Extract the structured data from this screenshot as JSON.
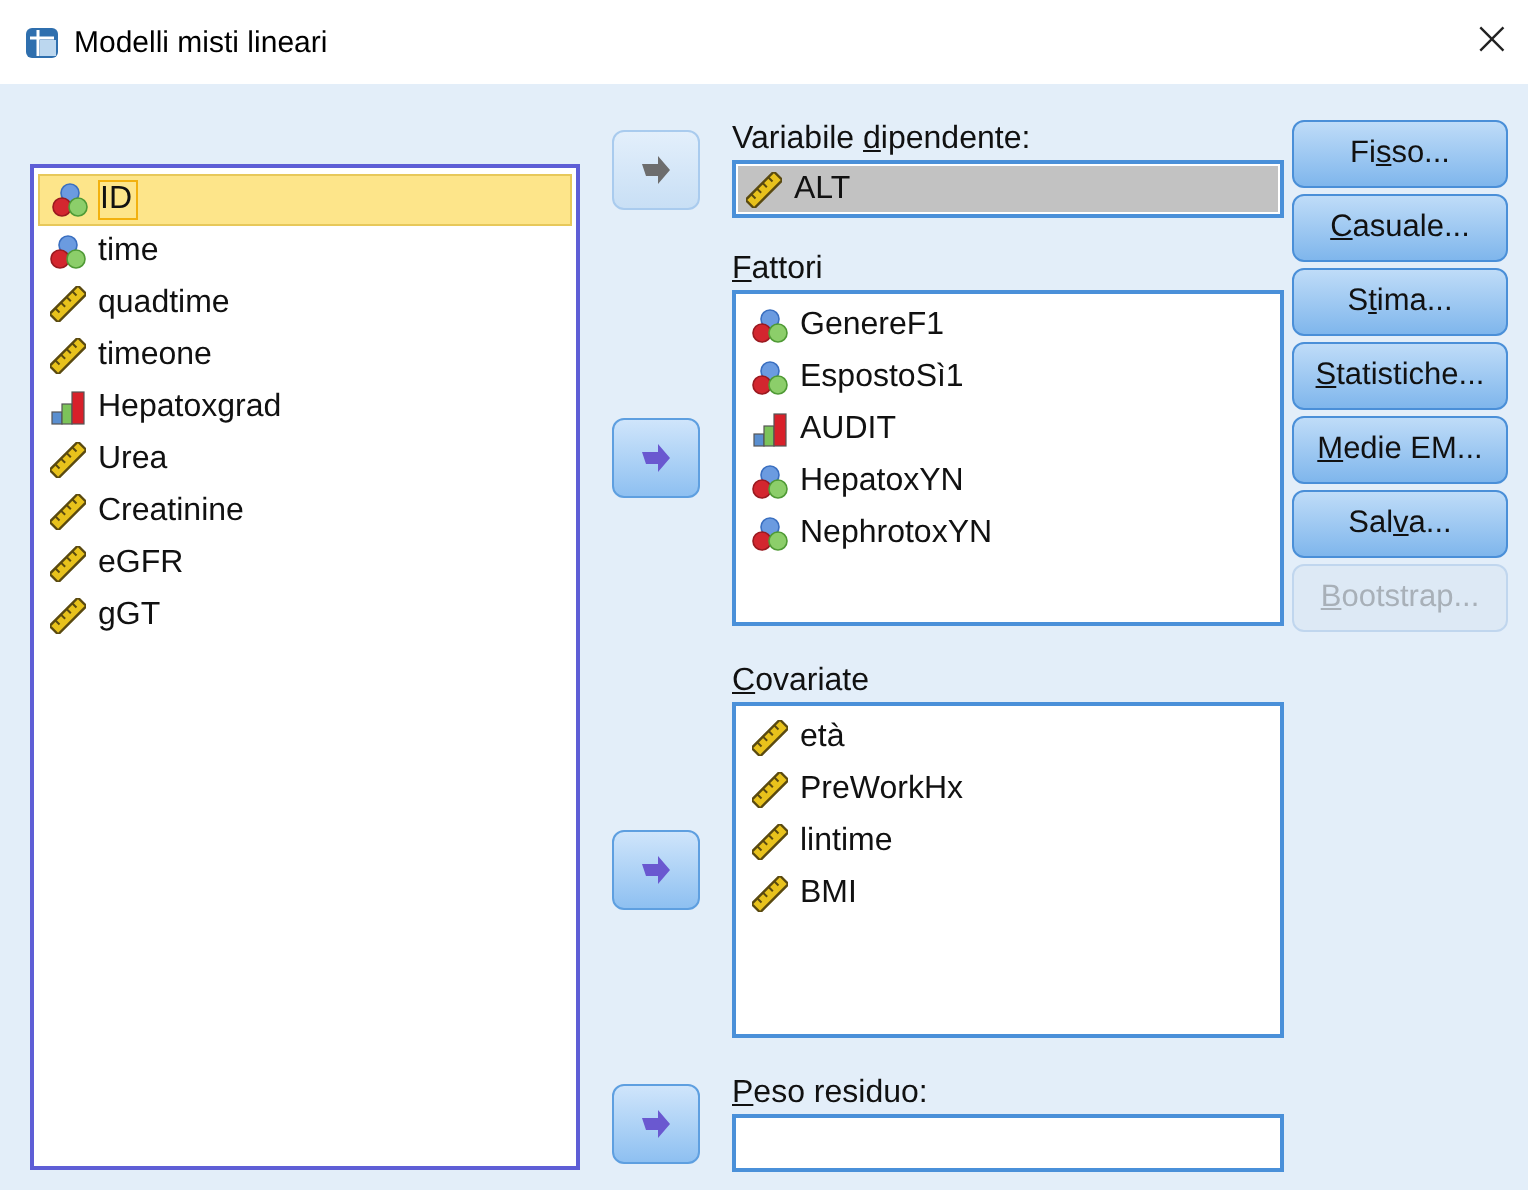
{
  "window": {
    "title": "Modelli misti lineari",
    "close": "×"
  },
  "variables": [
    {
      "name": "ID",
      "kind": "nominal",
      "selected": true
    },
    {
      "name": "time",
      "kind": "nominal",
      "selected": false
    },
    {
      "name": "quadtime",
      "kind": "scale",
      "selected": false
    },
    {
      "name": "timeone",
      "kind": "scale",
      "selected": false
    },
    {
      "name": "Hepatoxgrad",
      "kind": "ordinal",
      "selected": false
    },
    {
      "name": "Urea",
      "kind": "scale",
      "selected": false
    },
    {
      "name": "Creatinine",
      "kind": "scale",
      "selected": false
    },
    {
      "name": "eGFR",
      "kind": "scale",
      "selected": false
    },
    {
      "name": "gGT",
      "kind": "scale",
      "selected": false
    }
  ],
  "sections": [
    {
      "kind": "field",
      "label": {
        "before": "Variabile ",
        "key": "d",
        "after": "ipendente:"
      },
      "arrow_enabled": false,
      "items": [
        {
          "name": "ALT",
          "kind": "scale",
          "selected": true
        }
      ]
    },
    {
      "kind": "list",
      "label": {
        "key": "F",
        "after": "attori"
      },
      "arrow_enabled": true,
      "items": [
        {
          "name": "GenereF1",
          "kind": "nominal",
          "selected": false
        },
        {
          "name": "EspostoSì1",
          "kind": "nominal",
          "selected": false
        },
        {
          "name": "AUDIT",
          "kind": "ordinal",
          "selected": false
        },
        {
          "name": "HepatoxYN",
          "kind": "nominal",
          "selected": false
        },
        {
          "name": "NephrotoxYN",
          "kind": "nominal",
          "selected": false
        }
      ]
    },
    {
      "kind": "list",
      "label": {
        "key": "C",
        "after": "ovariate"
      },
      "arrow_enabled": true,
      "items": [
        {
          "name": "età",
          "kind": "scale",
          "selected": false
        },
        {
          "name": "PreWorkHx",
          "kind": "scale",
          "selected": false
        },
        {
          "name": "lintime",
          "kind": "scale",
          "selected": false
        },
        {
          "name": "BMI",
          "kind": "scale",
          "selected": false
        }
      ]
    },
    {
      "kind": "field",
      "label": {
        "key": "P",
        "after": "eso residuo:"
      },
      "arrow_enabled": true
    }
  ],
  "buttons": [
    {
      "label": {
        "before": "Fi",
        "key": "s",
        "after": "so..."
      },
      "disabled": false
    },
    {
      "label": {
        "key": "C",
        "after": "asuale..."
      },
      "disabled": false
    },
    {
      "label": {
        "before": "S",
        "key": "t",
        "after": "ima..."
      },
      "disabled": false
    },
    {
      "label": {
        "key": "S",
        "after": "tatistiche..."
      },
      "disabled": false
    },
    {
      "label": {
        "key": "M",
        "after": "edie EM..."
      },
      "disabled": false
    },
    {
      "label": {
        "before": "Sal",
        "key": "v",
        "after": "a..."
      },
      "disabled": false
    },
    {
      "label": {
        "key": "B",
        "after": "ootstrap..."
      },
      "disabled": true
    }
  ]
}
